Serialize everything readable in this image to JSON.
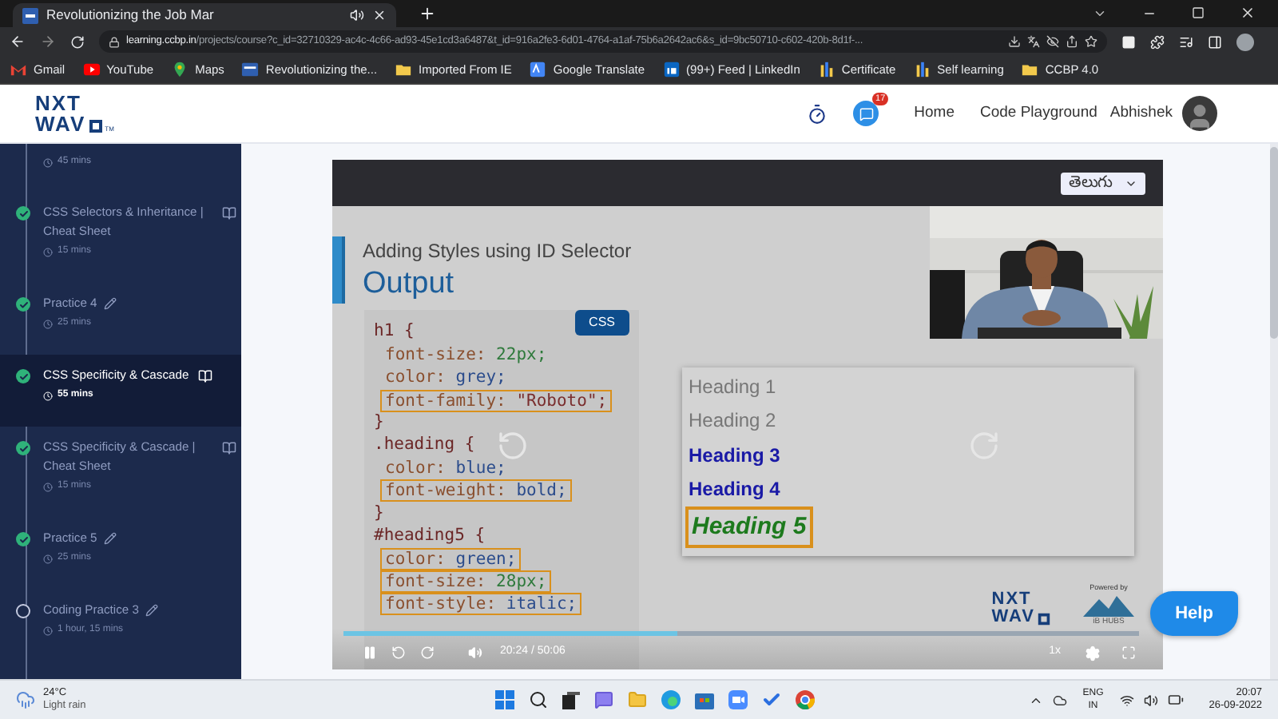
{
  "browser": {
    "tab": {
      "title": "Revolutionizing the Job Mar"
    },
    "url": {
      "domain": "learning.ccbp.in",
      "path": "/projects/course?c_id=32710329-ac4c-4c66-ad93-45e1cd3a6487&t_id=916a2fe3-6d01-4764-a1af-75b6a2642ac6&s_id=9bc50710-c602-420b-8d1f-..."
    },
    "bookmarks": [
      {
        "label": "Gmail",
        "kind": "gmail"
      },
      {
        "label": "YouTube",
        "kind": "youtube"
      },
      {
        "label": "Maps",
        "kind": "maps"
      },
      {
        "label": "Revolutionizing the...",
        "kind": "site"
      },
      {
        "label": "Imported From IE",
        "kind": "folder"
      },
      {
        "label": "Google Translate",
        "kind": "translate"
      },
      {
        "label": "(99+) Feed | LinkedIn",
        "kind": "linkedin"
      },
      {
        "label": "Certificate",
        "kind": "chart"
      },
      {
        "label": "Self learning",
        "kind": "chart"
      },
      {
        "label": "CCBP 4.0",
        "kind": "folder"
      }
    ]
  },
  "header": {
    "logo": {
      "line1": "NXT",
      "line2": "WAV",
      "mark": "TM"
    },
    "chat_badge": "17",
    "nav": [
      "Home",
      "Code Playground"
    ],
    "user": "Abhishek"
  },
  "sidebar": {
    "items": [
      {
        "kind": "partial",
        "duration": "45 mins"
      },
      {
        "kind": "reading",
        "title": "CSS Selectors & Inheritance | Cheat Sheet",
        "duration": "15 mins",
        "done": true,
        "selected": false
      },
      {
        "kind": "practice",
        "title": "Practice 4",
        "duration": "25 mins",
        "done": true,
        "selected": false
      },
      {
        "kind": "reading",
        "title": "CSS Specificity & Cascade",
        "duration": "55 mins",
        "done": true,
        "selected": true
      },
      {
        "kind": "reading",
        "title": "CSS Specificity & Cascade | Cheat Sheet",
        "duration": "15 mins",
        "done": true,
        "selected": false
      },
      {
        "kind": "practice",
        "title": "Practice 5",
        "duration": "25 mins",
        "done": true,
        "selected": false
      },
      {
        "kind": "practice",
        "title": "Coding Practice 3",
        "duration": "1 hour, 15 mins",
        "done": false,
        "selected": false
      }
    ]
  },
  "video": {
    "language": "తెలుగు",
    "slide": {
      "subtitle": "Adding Styles using ID Selector",
      "title": "Output",
      "badge": "CSS",
      "code": [
        {
          "kind": "selector",
          "text": "h1 {"
        },
        {
          "kind": "number",
          "property": "font-size:",
          "value": "22px;",
          "highlighted": false
        },
        {
          "kind": "keyword",
          "property": "color:",
          "value": "grey;",
          "highlighted": false
        },
        {
          "kind": "string",
          "property": "font-family:",
          "value": "\"Roboto\";",
          "highlighted": true
        },
        {
          "kind": "selector",
          "text": "}"
        },
        {
          "kind": "selector",
          "text": ".heading {"
        },
        {
          "kind": "keyword",
          "property": "color:",
          "value": "blue;",
          "highlighted": false
        },
        {
          "kind": "keyword",
          "property": "font-weight:",
          "value": "bold;",
          "highlighted": true
        },
        {
          "kind": "selector",
          "text": "}"
        },
        {
          "kind": "selector",
          "text": "#heading5 {"
        },
        {
          "kind": "keyword",
          "property": "color:",
          "value": "green;",
          "highlighted": true
        },
        {
          "kind": "number",
          "property": "font-size:",
          "value": "28px;",
          "highlighted": true
        },
        {
          "kind": "keyword",
          "property": "font-style:",
          "value": "italic;",
          "highlighted": true
        }
      ],
      "headings": [
        {
          "text": "Heading 1",
          "kind": "grey",
          "highlighted": false
        },
        {
          "text": "Heading 2",
          "kind": "grey",
          "highlighted": false
        },
        {
          "text": "Heading 3",
          "kind": "blue",
          "highlighted": false
        },
        {
          "text": "Heading 4",
          "kind": "blue",
          "highlighted": false
        },
        {
          "text": "Heading 5",
          "kind": "green",
          "highlighted": true
        }
      ],
      "logo": {
        "line1": "NXT",
        "line2": "WAV"
      },
      "powered_by": "Powered by",
      "partner": "iB HUBS"
    },
    "progress": {
      "level": 0.42
    },
    "time": "20:24 / 50:06",
    "speed": "1x"
  },
  "help_button": "Help",
  "taskbar": {
    "weather": {
      "temp": "24°C",
      "text": "Light rain"
    },
    "language": [
      "ENG",
      "IN"
    ],
    "time": "20:07",
    "date": "26-09-2022"
  }
}
